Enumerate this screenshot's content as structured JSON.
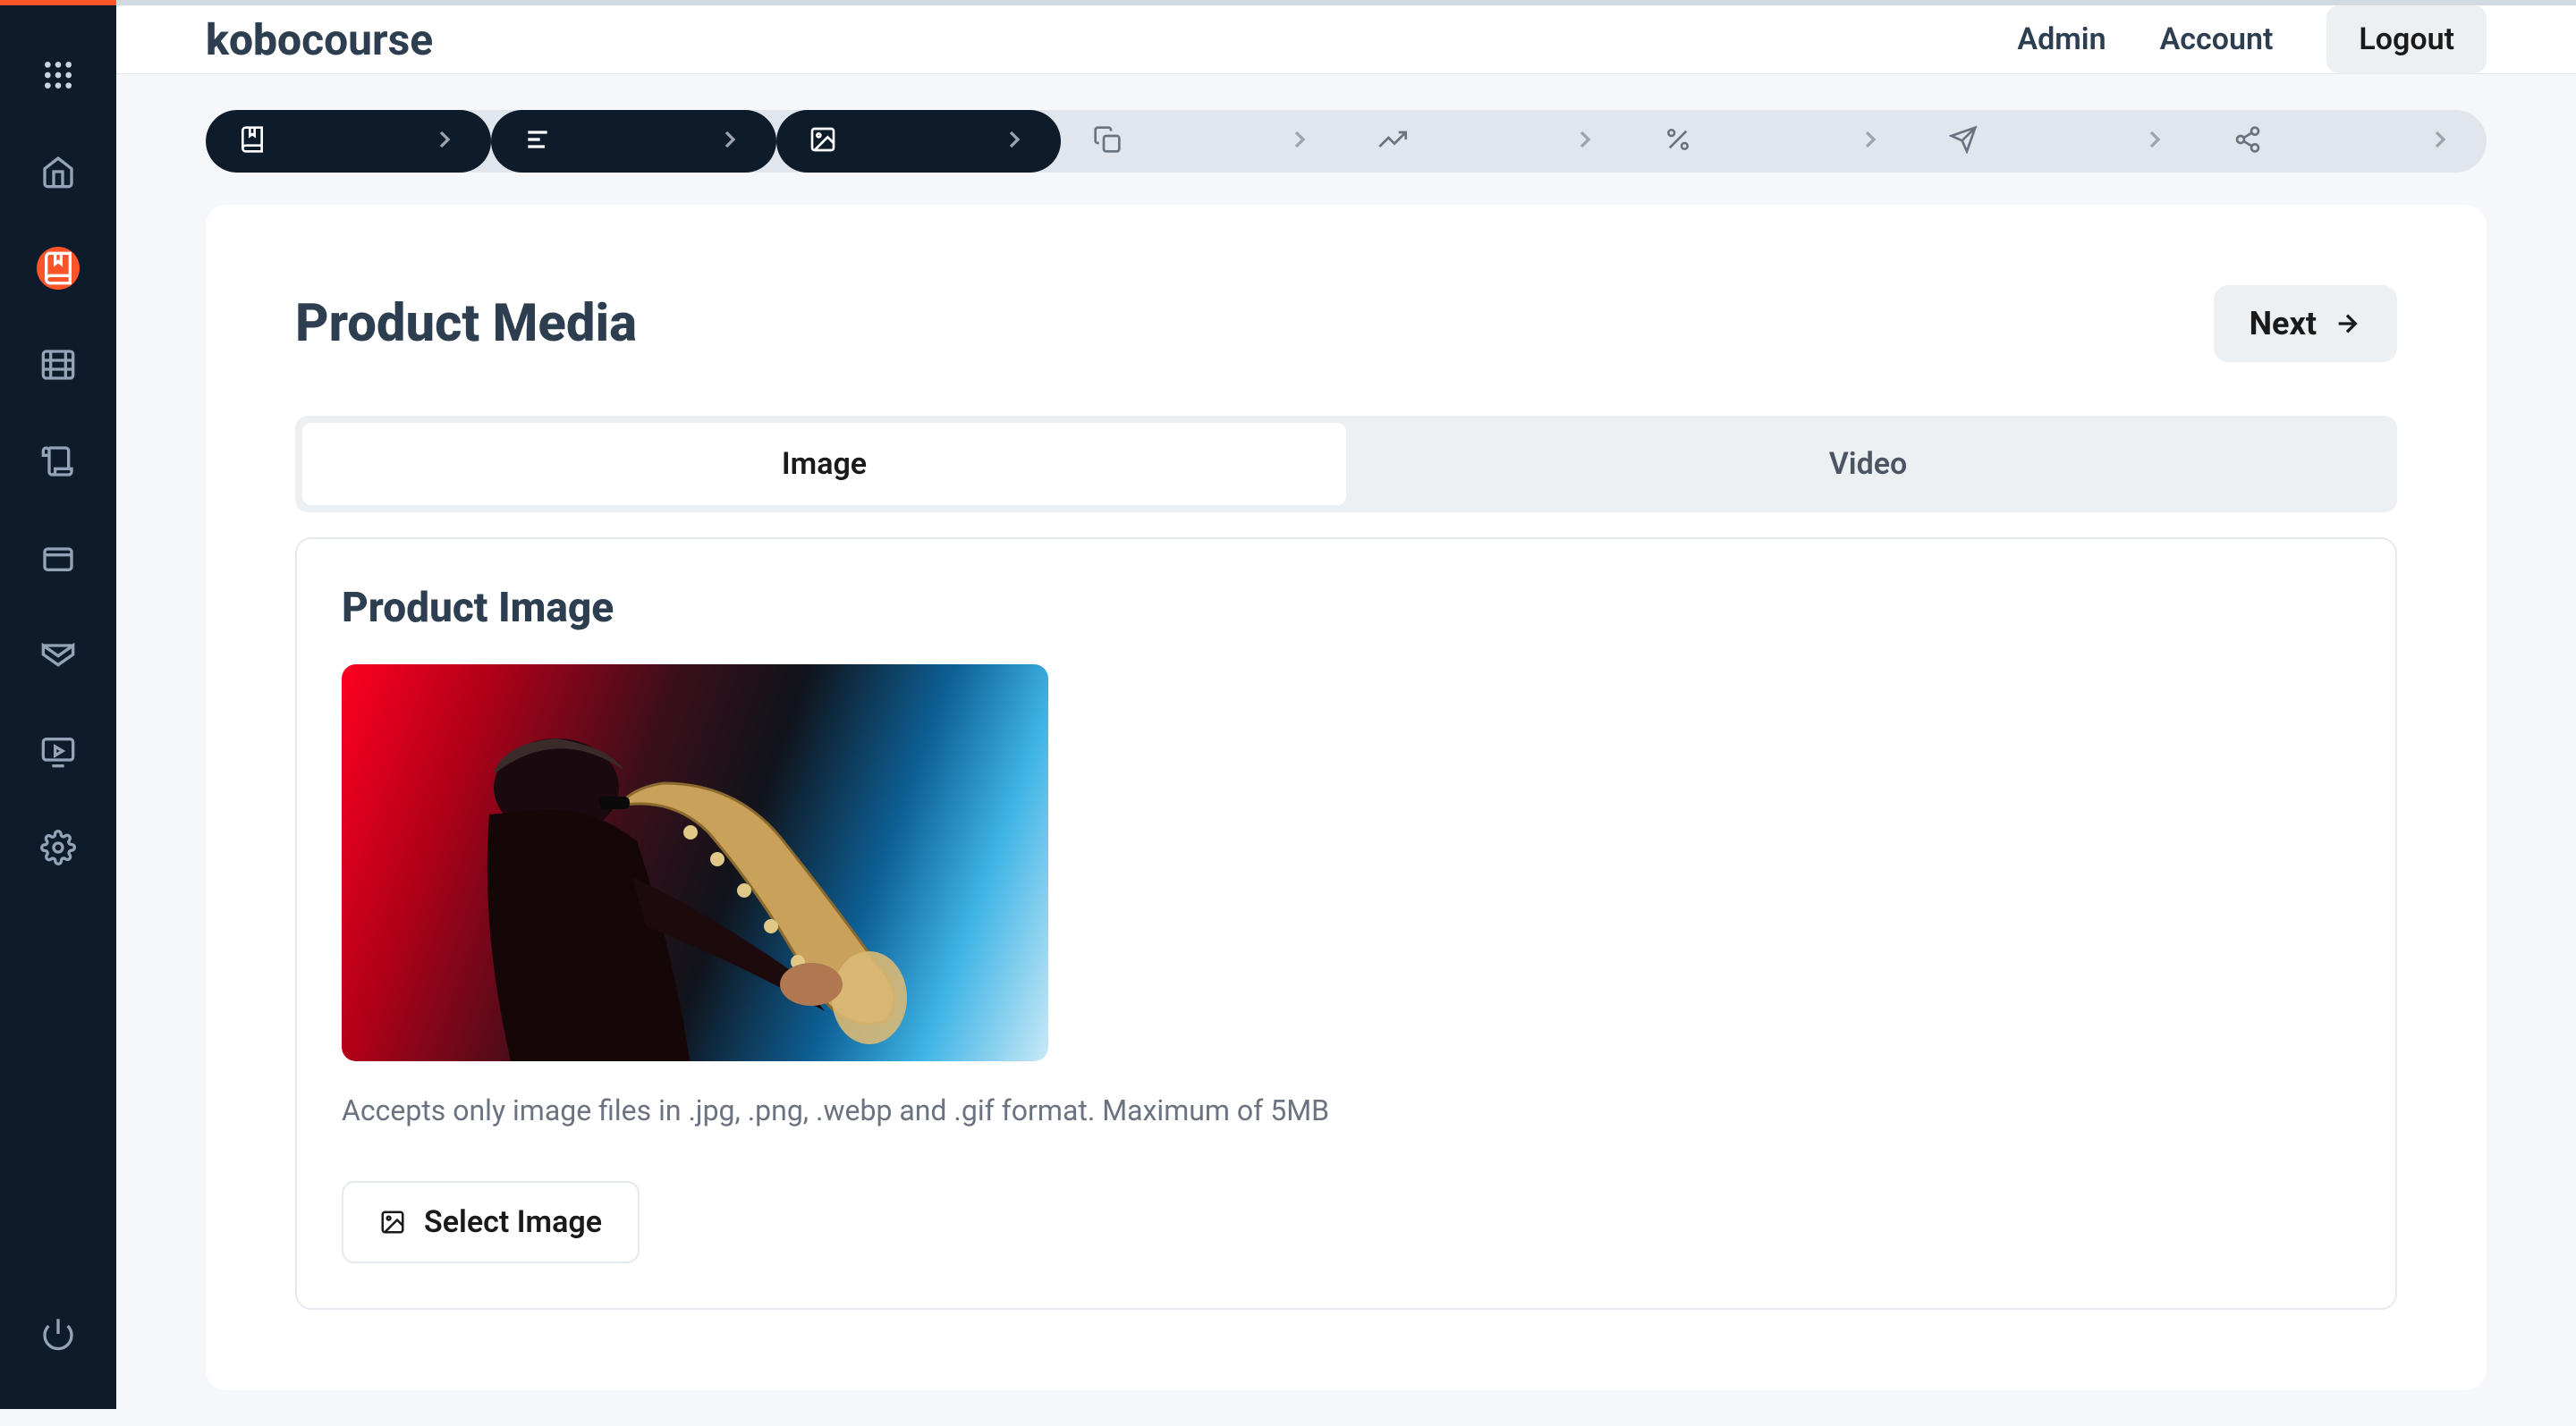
{
  "brand": {
    "bold": "kobo",
    "rest": "course"
  },
  "top_nav": {
    "admin": "Admin",
    "account": "Account",
    "logout": "Logout"
  },
  "page": {
    "title": "Product Media",
    "next_label": "Next"
  },
  "tabs": {
    "image": "Image",
    "video": "Video"
  },
  "panel": {
    "title": "Product Image",
    "helper": "Accepts only image files in .jpg, .png, .webp and .gif format. Maximum of 5MB",
    "select_button": "Select Image"
  }
}
